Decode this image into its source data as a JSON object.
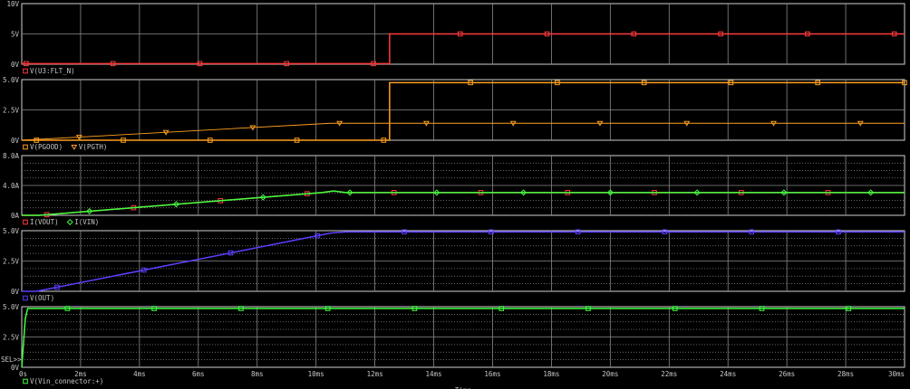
{
  "colors": {
    "bg": "#000000",
    "frame": "#cfcfcf",
    "grid": "#8a8a8a",
    "text": "#c8c8c8",
    "red": "#ff3b3b",
    "orange": "#ffa020",
    "green": "#40ff40",
    "blue": "#5a40ff"
  },
  "chart_data": {
    "type": "line",
    "x_axis": {
      "unit": "ms",
      "range": [
        0,
        30
      ],
      "ticks": [
        0,
        2,
        4,
        6,
        8,
        10,
        12,
        14,
        16,
        18,
        20,
        22,
        24,
        26,
        28,
        30
      ],
      "tick_labels": [
        "0s",
        "2ms",
        "4ms",
        "6ms",
        "8ms",
        "10ms",
        "12ms",
        "14ms",
        "16ms",
        "18ms",
        "20ms",
        "22ms",
        "24ms",
        "26ms",
        "28ms",
        "30ms"
      ],
      "label": "Time"
    },
    "plots": [
      {
        "ylim": [
          0,
          10
        ],
        "grid": "major",
        "y_ticks": [
          {
            "v": 0,
            "label": "0V"
          },
          {
            "v": 5,
            "label": "5V"
          },
          {
            "v": 10,
            "label": "10V"
          }
        ],
        "series": [
          {
            "name": "V(U3:FLT_N)",
            "color": "red",
            "marker": "square",
            "x": [
              0,
              12.5,
              12.5,
              30
            ],
            "y": [
              0.1,
              0.1,
              5.0,
              5.0
            ]
          }
        ]
      },
      {
        "ylim": [
          0,
          5
        ],
        "grid": "major",
        "y_ticks": [
          {
            "v": 0,
            "label": "0V"
          },
          {
            "v": 2.5,
            "label": "2.5V"
          },
          {
            "v": 5,
            "label": "5.0V"
          }
        ],
        "series": [
          {
            "name": "V(PGOOD)",
            "color": "orange",
            "marker": "square",
            "bold": true,
            "x": [
              0,
              12.5,
              12.5,
              30
            ],
            "y": [
              0,
              0,
              4.75,
              4.75
            ]
          },
          {
            "name": "V(PGTH)",
            "color": "orange",
            "marker": "triangle",
            "bold": false,
            "x": [
              0,
              10.5,
              30
            ],
            "y": [
              0,
              1.4,
              1.4
            ]
          }
        ]
      },
      {
        "ylim": [
          0,
          8
        ],
        "grid": "dotted",
        "y_ticks": [
          {
            "v": 0,
            "label": "0A"
          },
          {
            "v": 4,
            "label": "4.0A"
          },
          {
            "v": 8,
            "label": "8.0A"
          }
        ],
        "series": [
          {
            "name": "I(VOUT)",
            "color": "red",
            "marker": "square",
            "x": [
              0,
              0.6,
              10.2,
              10.6,
              11,
              30
            ],
            "y": [
              0,
              0,
              3.05,
              3.25,
              3.05,
              3.05
            ]
          },
          {
            "name": "I(VIN)",
            "color": "green",
            "marker": "diamond",
            "x": [
              0,
              0.6,
              10.2,
              10.6,
              11,
              30
            ],
            "y": [
              0,
              0,
              3.05,
              3.25,
              3.05,
              3.05
            ]
          }
        ]
      },
      {
        "ylim": [
          0,
          5
        ],
        "grid": "dotted",
        "y_ticks": [
          {
            "v": 0,
            "label": "0V"
          },
          {
            "v": 2.5,
            "label": "2.5V"
          },
          {
            "v": 5,
            "label": "5.0V"
          }
        ],
        "series": [
          {
            "name": "V(OUT)",
            "color": "blue",
            "marker": "square",
            "x": [
              0,
              0.5,
              10.5,
              11,
              30
            ],
            "y": [
              0,
              0,
              4.8,
              4.9,
              4.9
            ]
          }
        ]
      },
      {
        "ylim": [
          0,
          5
        ],
        "grid": "dotted",
        "sel": true,
        "y_ticks": [
          {
            "v": 0,
            "label": "0V"
          },
          {
            "v": 2.5,
            "label": "2.5V"
          },
          {
            "v": 5,
            "label": "5.0V"
          }
        ],
        "series": [
          {
            "name": "V(Vin_connector:+)",
            "color": "green",
            "marker": "square",
            "x": [
              0,
              0.12,
              0.2,
              30
            ],
            "y": [
              0,
              4.0,
              4.85,
              4.85
            ]
          }
        ]
      }
    ]
  },
  "sel_label": "SEL>>"
}
